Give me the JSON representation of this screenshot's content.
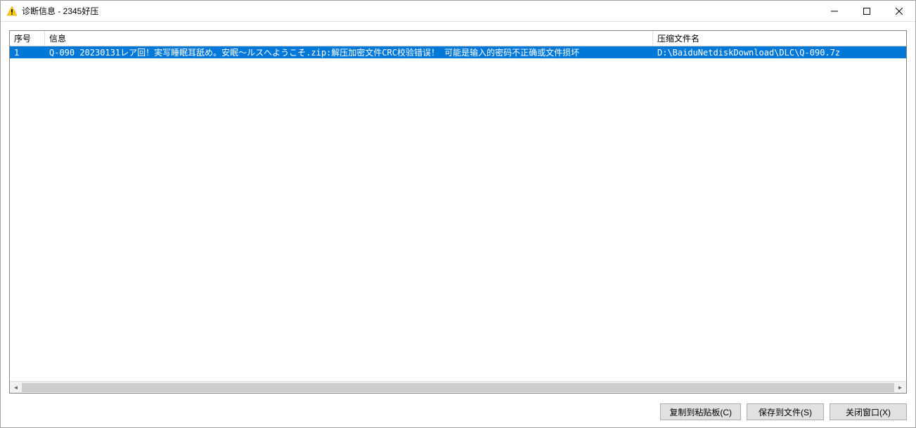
{
  "window": {
    "title": "诊断信息 - 2345好压"
  },
  "table": {
    "headers": {
      "seq": "序号",
      "info": "信息",
      "file": "压缩文件名"
    },
    "rows": [
      {
        "seq": "1",
        "info": "Q-090  20230131レア回！実写睡眠耳舐め。安眠～ルスへようこそ.zip:解压加密文件CRC校验错误！ 可能是输入的密码不正确或文件损坏",
        "file": "D:\\BaiduNetdiskDownload\\DLC\\Q-090.7z"
      }
    ]
  },
  "buttons": {
    "copy": "复制到粘贴板(C)",
    "save": "保存到文件(S)",
    "close": "关闭窗口(X)"
  }
}
